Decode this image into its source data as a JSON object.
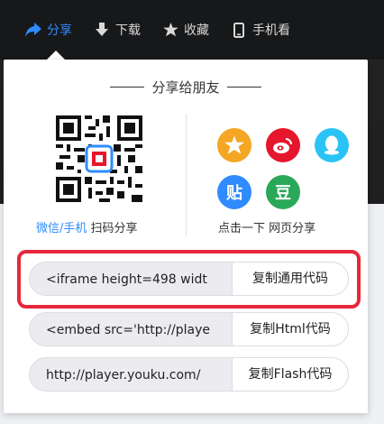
{
  "topbar": {
    "tabs": [
      {
        "label": "分享",
        "icon": "share-arrow-icon",
        "active": true
      },
      {
        "label": "下载",
        "icon": "download-icon"
      },
      {
        "label": "收藏",
        "icon": "star-icon"
      },
      {
        "label": "手机看",
        "icon": "phone-icon"
      }
    ]
  },
  "share": {
    "title": "分享给朋友",
    "qr_caption_link": "微信/手机",
    "qr_caption_rest": " 扫码分享",
    "right_caption": "点击一下 网页分享",
    "services": [
      {
        "name": "qzone",
        "glyph": "★",
        "color": "#f5a623"
      },
      {
        "name": "weibo",
        "glyph": "微",
        "color": "#e6162d"
      },
      {
        "name": "qq",
        "glyph": "Q",
        "color": "#2bc3f5"
      },
      {
        "name": "tieba",
        "glyph": "贴",
        "color": "#2f8bff"
      },
      {
        "name": "douban",
        "glyph": "豆",
        "color": "#2aa85a"
      }
    ]
  },
  "codes": [
    {
      "value": "<iframe height=498 widt",
      "button": "复制通用代码"
    },
    {
      "value": "<embed src='http://playe",
      "button": "复制Html代码"
    },
    {
      "value": "http://player.youku.com/",
      "button": "复制Flash代码"
    }
  ],
  "colors": {
    "accent": "#2f8bff",
    "highlight": "#e8273b"
  }
}
